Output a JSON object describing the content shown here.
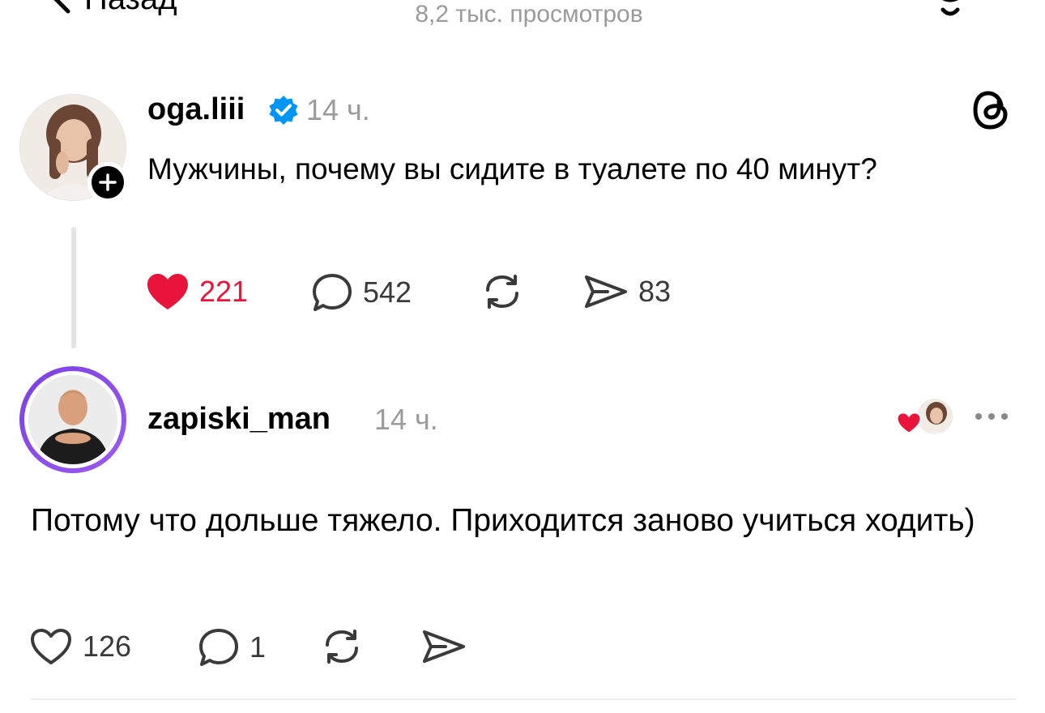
{
  "header": {
    "back_label": "Назад",
    "views_text": "8,2 тыс. просмотров"
  },
  "post": {
    "username": "oga.liii",
    "verified": true,
    "time": "14 ч.",
    "text": "Мужчины, почему вы сидите в туалете по 40 минут?",
    "liked_by_viewer": true,
    "likes": "221",
    "comments": "542",
    "shares": "83"
  },
  "reply": {
    "username": "zapiski_man",
    "time": "14 ч.",
    "liked_by_author": true,
    "text": "Потому что дольше тяжело. Приходится заново учиться ходить)",
    "likes": "126",
    "comments": "1"
  },
  "icons": {
    "back": "chevron-left-icon",
    "notifications": "bell-icon",
    "brand": "threads-logo-icon",
    "verified": "verified-badge-icon",
    "follow": "plus-icon",
    "like": "heart-icon",
    "comment": "comment-bubble-icon",
    "repost": "repost-icon",
    "share": "paper-plane-icon",
    "more": "more-dots-icon"
  },
  "colors": {
    "like_active": "#e8143a",
    "verified_blue": "#0095f6",
    "muted_text": "#9b9b9b",
    "avatar_ring": "#7b3fe4"
  }
}
